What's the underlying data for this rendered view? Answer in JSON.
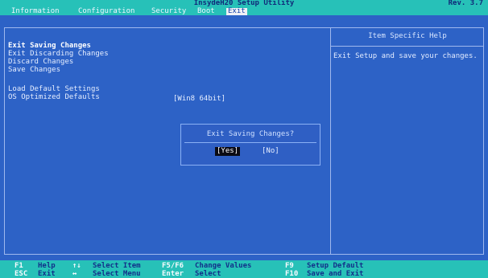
{
  "header": {
    "title": "InsydeH20 Setup Utility",
    "revision": "Rev. 3.7"
  },
  "tabs": [
    {
      "label": "Information"
    },
    {
      "label": "Configuration"
    },
    {
      "label": "Security"
    },
    {
      "label": "Boot"
    },
    {
      "label": "Exit"
    }
  ],
  "menu": {
    "items": [
      {
        "label": "Exit Saving Changes"
      },
      {
        "label": "Exit Discarding Changes"
      },
      {
        "label": "Discard Changes"
      },
      {
        "label": "Save Changes"
      },
      {
        "label": "Load Default Settings"
      },
      {
        "label": "OS Optimized Defaults"
      }
    ],
    "os_optimized_value": "[Win8 64bit]"
  },
  "help": {
    "title": "Item Specific Help",
    "text": "Exit Setup and save your changes."
  },
  "dialog": {
    "title": "Exit Saving Changes?",
    "yes_label": "[Yes]",
    "no_label": "[No]"
  },
  "footer": {
    "keys": [
      {
        "key": "F1",
        "desc": "Help"
      },
      {
        "key": "ESC",
        "desc": "Exit"
      },
      {
        "key": "↑↓",
        "desc": "Select Item"
      },
      {
        "key": "↔",
        "desc": "Select Menu"
      },
      {
        "key": "F5/F6",
        "desc": "Change Values"
      },
      {
        "key": "Enter",
        "desc": "Select"
      },
      {
        "key": "F9",
        "desc": "Setup Default"
      },
      {
        "key": "F10",
        "desc": "Save and Exit"
      }
    ]
  },
  "colors": {
    "background": "#2d62c6",
    "bar": "#27c1b8",
    "highlight": "#eef0f6"
  }
}
